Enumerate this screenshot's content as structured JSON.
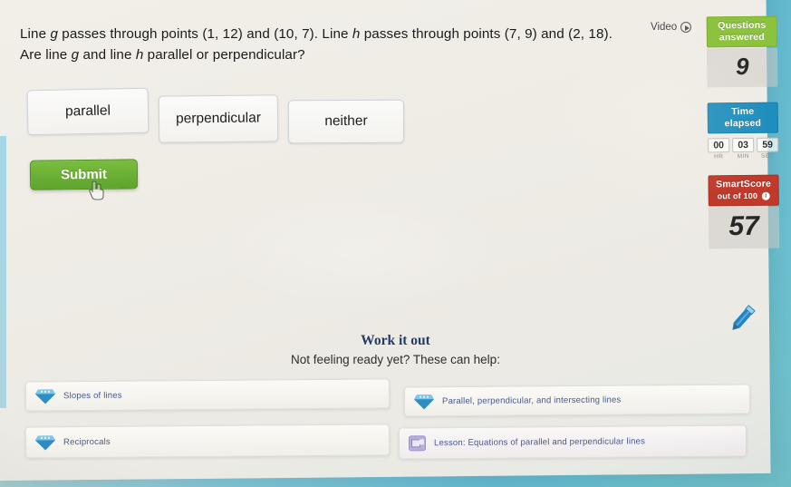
{
  "question": {
    "line1_a": "Line ",
    "var_g": "g",
    "line1_b": " passes through points (1, 12) and (10, 7). Line ",
    "var_h": "h",
    "line1_c": " passes through points (7, 9) and (2, 18). Are line ",
    "var_g2": "g",
    "line1_d": " and line ",
    "var_h2": "h",
    "line1_e": " parallel or perpendicular?",
    "full_text": "Line g passes through points (1, 12) and (10, 7). Line h passes through points (7, 9) and (2, 18). Are line g and line h parallel or perpendicular?"
  },
  "choices": [
    {
      "label": "parallel"
    },
    {
      "label": "perpendicular"
    },
    {
      "label": "neither"
    }
  ],
  "submit": {
    "label": "Submit"
  },
  "video": {
    "label": "Video",
    "icon": "play-circle-icon"
  },
  "stats": {
    "questions": {
      "badge_line1": "Questions",
      "badge_line2": "answered",
      "value": "9",
      "color": "#8cc23d"
    },
    "time": {
      "badge_line1": "Time",
      "badge_line2": "elapsed",
      "color": "#1c8dbd"
    },
    "timer": [
      {
        "value": "00",
        "unit": "HR"
      },
      {
        "value": "03",
        "unit": "MIN"
      },
      {
        "value": "59",
        "unit": "SEC"
      }
    ],
    "smartscore": {
      "badge_line1": "SmartScore",
      "badge_line2": "out of 100",
      "info": "i",
      "value": "57",
      "color": "#c0392b"
    }
  },
  "work_it_out": {
    "title": "Work it out",
    "subtitle": "Not feeling ready yet? These can help:"
  },
  "help_items": [
    {
      "label": "Slopes of lines",
      "icon": "gem-icon"
    },
    {
      "label": "Reciprocals",
      "icon": "gem-icon"
    },
    {
      "label": "Parallel, perpendicular, and intersecting lines",
      "icon": "gem-icon"
    },
    {
      "label": "Lesson: Equations of parallel and perpendicular lines",
      "icon": "lesson-video-icon"
    }
  ],
  "theme": {
    "submit_green": "#6cb035",
    "badge_green": "#8cc23d",
    "badge_blue": "#1c8dbd",
    "badge_red": "#c0392b",
    "link_blue": "#49598e",
    "work_title_navy": "#243b63",
    "gem_blue": "#3e9bd4",
    "pencil_blue": "#2383c4"
  }
}
